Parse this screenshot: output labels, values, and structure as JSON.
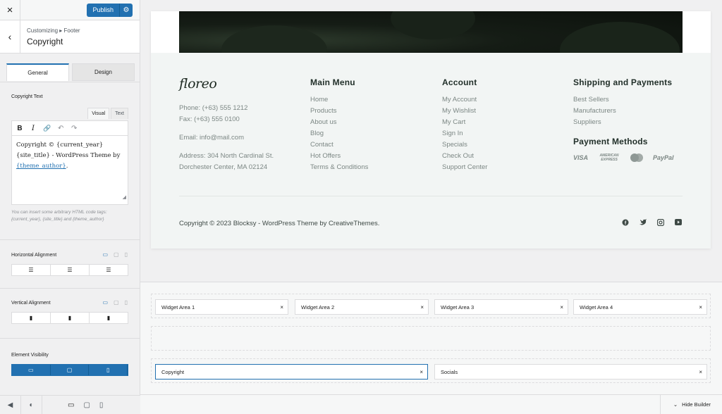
{
  "sidebar": {
    "close_icon": "×",
    "publish_label": "Publish",
    "publish_gear_icon": "⚙",
    "back_icon": "‹",
    "breadcrumb": "Customizing ▸ Footer",
    "title": "Copyright",
    "tabs": [
      "General",
      "Design"
    ],
    "copyright_text_label": "Copyright Text",
    "editor": {
      "mode_tabs": [
        "Visual",
        "Text"
      ],
      "toolbar": [
        "B",
        "I",
        "🔗",
        "↶",
        "↷"
      ],
      "content_line1": "Copyright © {current_year}",
      "content_line2": "{site_title} - WordPress Theme by",
      "content_link": "{theme_author}",
      "content_end": "."
    },
    "hint": "You can insert some arbitrary HTML code tags: {current_year}, {site_title} and {theme_author}",
    "horizontal_alignment_label": "Horizontal Alignment",
    "vertical_alignment_label": "Vertical Alignment",
    "element_visibility_label": "Element Visibility",
    "bottom_bar": {
      "collapse_icon": "◀",
      "dark_mode_icon": "◐",
      "desktop_icon": "🖥",
      "tablet_icon": "▭",
      "mobile_icon": "▯"
    }
  },
  "preview": {
    "logo": "floreo",
    "contact": {
      "phone": "Phone: (+63) 555 1212",
      "fax": "Fax: (+63) 555 0100",
      "email": "Email: info@mail.com",
      "address1": "Address: 304 North Cardinal St.",
      "address2": "Dorchester Center, MA 02124"
    },
    "main_menu": {
      "title": "Main Menu",
      "items": [
        "Home",
        "Products",
        "About us",
        "Blog",
        "Contact",
        "Hot Offers",
        "Terms & Conditions"
      ]
    },
    "account": {
      "title": "Account",
      "items": [
        "My Account",
        "My Wishlist",
        "My Cart",
        "Sign In",
        "Specials",
        "Check Out",
        "Support Center"
      ]
    },
    "shipping": {
      "title": "Shipping and Payments",
      "items": [
        "Best Sellers",
        "Manufacturers",
        "Suppliers"
      ]
    },
    "payment": {
      "title": "Payment Methods",
      "cards": [
        "VISA",
        "AMERICAN EXPRESS",
        "PayPal"
      ]
    },
    "copyright": "Copyright © 2023 Blocksy - WordPress Theme by CreativeThemes.",
    "social_icons": [
      "facebook-icon",
      "twitter-icon",
      "instagram-icon",
      "youtube-icon"
    ]
  },
  "builder": {
    "widget_areas": [
      "Widget Area 1",
      "Widget Area 2",
      "Widget Area 3",
      "Widget Area 4"
    ],
    "bottom_row": [
      "Copyright",
      "Socials"
    ],
    "remove_icon": "×",
    "hide_builder_label": "Hide Builder",
    "hide_builder_icon": "⌄"
  },
  "colors": {
    "accent": "#2271b1",
    "panel_bg": "#f0f0f1",
    "footer_bg": "#f2f5f4"
  }
}
